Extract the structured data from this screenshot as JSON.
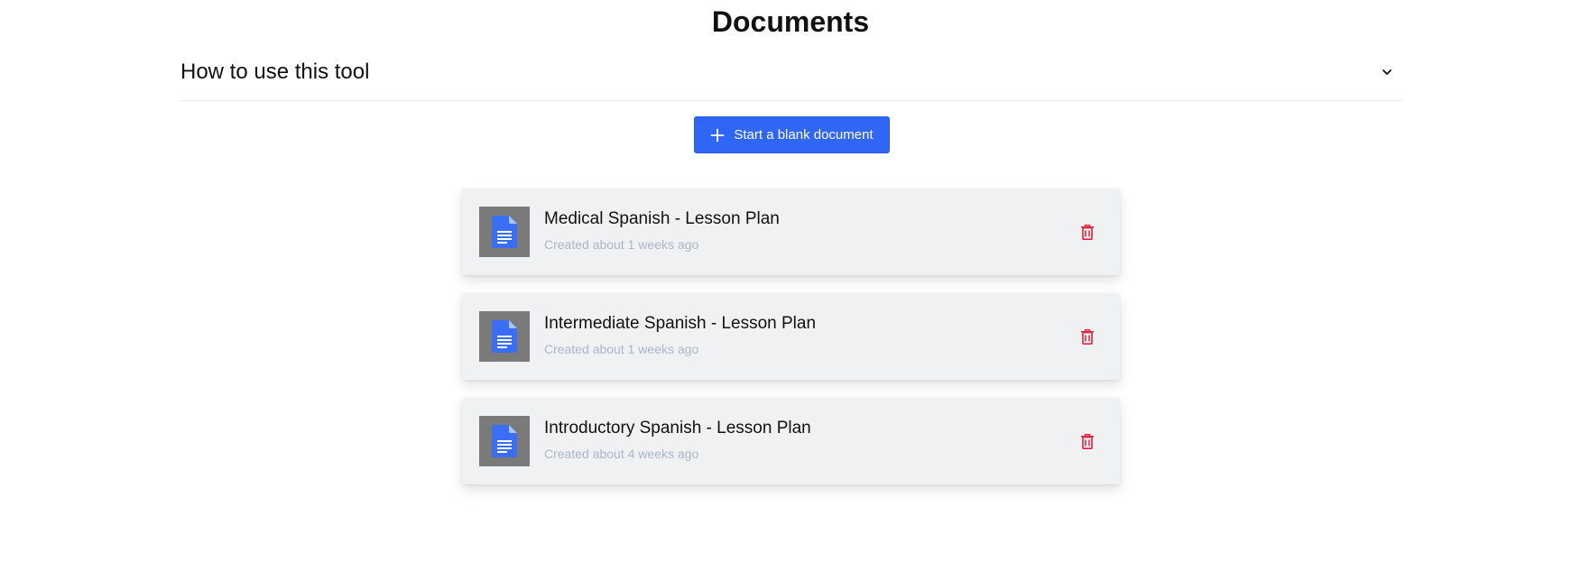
{
  "page": {
    "title": "Documents"
  },
  "help": {
    "title": "How to use this tool",
    "expanded": false,
    "icon": "chevron-down-icon"
  },
  "actions": {
    "new_document_label": "Start a blank document",
    "new_document_icon": "plus-icon"
  },
  "documents": [
    {
      "title": "Medical Spanish - Lesson Plan",
      "created": "Created about 1 weeks ago",
      "icon": "google-doc-icon",
      "delete_icon": "trash-icon"
    },
    {
      "title": "Intermediate Spanish - Lesson Plan",
      "created": "Created about 1 weeks ago",
      "icon": "google-doc-icon",
      "delete_icon": "trash-icon"
    },
    {
      "title": "Introductory Spanish - Lesson Plan",
      "created": "Created about 4 weeks ago",
      "icon": "google-doc-icon",
      "delete_icon": "trash-icon"
    }
  ],
  "colors": {
    "primary": "#2f66f5",
    "danger": "#e0243f",
    "card_background": "#f0f1f3",
    "muted_text": "#aab6c8",
    "doc_icon": "#3a6ef5"
  }
}
